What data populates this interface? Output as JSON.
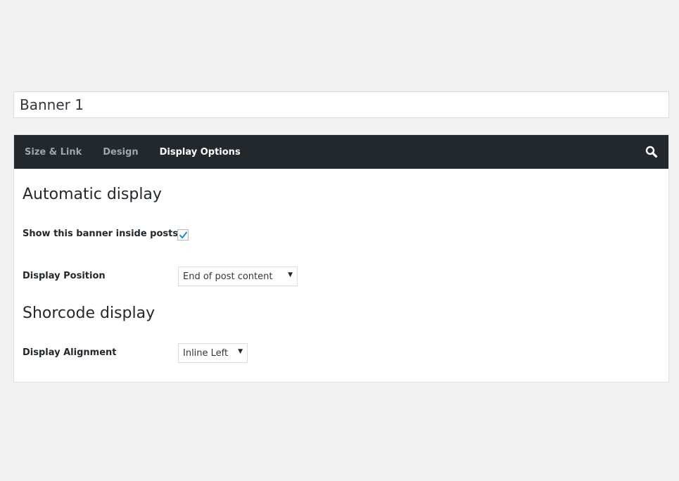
{
  "banner_title": {
    "value": "Banner 1"
  },
  "tabs": [
    {
      "label": "Size & Link",
      "active": false
    },
    {
      "label": "Design",
      "active": false
    },
    {
      "label": "Display Options",
      "active": true
    }
  ],
  "icons": {
    "search": "search-icon",
    "checkmark": "checkmark-icon",
    "dropdown_arrow": "caret-down-icon"
  },
  "automatic_display": {
    "heading": "Automatic display",
    "show_inside_posts": {
      "label": "Show this banner inside posts",
      "checked": true
    },
    "display_position": {
      "label": "Display Position",
      "selected": "End of post content",
      "arrow": "▼"
    }
  },
  "shortcode_display": {
    "heading": "Shorcode display",
    "display_alignment": {
      "label": "Display Alignment",
      "selected": "Inline Left",
      "arrow": "▼"
    }
  },
  "colors": {
    "background": "#f1f1f1",
    "tabbar": "#23282d",
    "tab_inactive": "#a0a5aa",
    "tab_active": "#ffffff",
    "checkmark": "#1e8cbe"
  }
}
